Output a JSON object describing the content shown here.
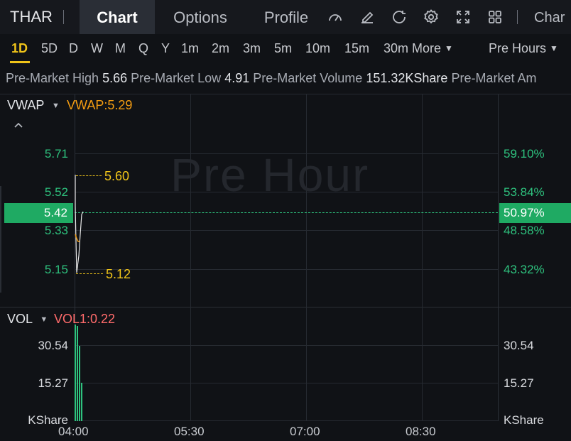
{
  "topnav": {
    "ticker": "THAR",
    "tabs": [
      {
        "label": "Chart"
      },
      {
        "label": "Options"
      },
      {
        "label": "Profile"
      }
    ],
    "trailing_label": "Char",
    "icons": [
      "gauge-icon",
      "edit-icon",
      "refresh-icon",
      "settings-icon",
      "fullscreen-icon",
      "grid-icon"
    ]
  },
  "periods": {
    "items": [
      "1D",
      "5D",
      "D",
      "W",
      "M",
      "Q",
      "Y",
      "1m",
      "2m",
      "3m",
      "5m",
      "10m",
      "15m",
      "30m",
      "More"
    ],
    "active": "1D",
    "session": "Pre Hours"
  },
  "stats": {
    "high_label": "Pre-Market High",
    "high_value": "5.66",
    "low_label": "Pre-Market Low",
    "low_value": "4.91",
    "volume_label": "Pre-Market Volume",
    "volume_value": "151.32KShare",
    "amount_label": "Pre-Market Am"
  },
  "price_panel": {
    "indicator": "VWAP",
    "indicator_value": "VWAP:5.29",
    "watermark": "Pre Hour",
    "left_ticks": [
      "5.71",
      "5.52",
      "5.33",
      "5.15"
    ],
    "right_ticks": [
      "59.10%",
      "53.84%",
      "48.58%",
      "43.32%"
    ],
    "current_price": "5.42",
    "current_pct": "50.97%",
    "high_marker": "5.60",
    "low_marker": "5.12"
  },
  "volume_panel": {
    "indicator": "VOL",
    "indicator_value": "VOL1:0.22",
    "left_ticks": [
      "30.54",
      "15.27",
      "KShare"
    ],
    "right_ticks": [
      "30.54",
      "15.27",
      "KShare"
    ]
  },
  "time_axis": [
    "04:00",
    "05:30",
    "07:00",
    "08:30"
  ],
  "colors": {
    "accent": "#f0c419",
    "up": "#2ec27e",
    "vwap": "#f39c12",
    "vol_label": "#ff6b6b"
  }
}
